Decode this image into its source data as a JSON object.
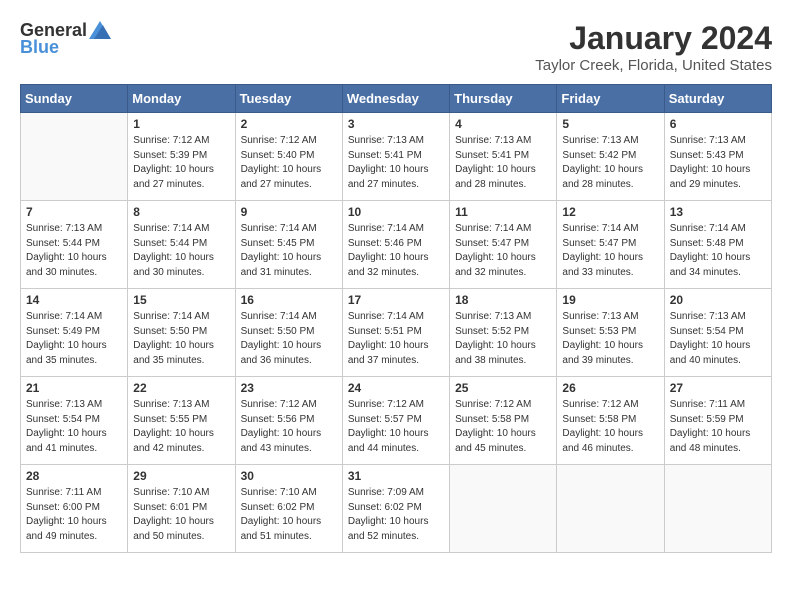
{
  "header": {
    "logo_general": "General",
    "logo_blue": "Blue",
    "title": "January 2024",
    "subtitle": "Taylor Creek, Florida, United States"
  },
  "days_of_week": [
    "Sunday",
    "Monday",
    "Tuesday",
    "Wednesday",
    "Thursday",
    "Friday",
    "Saturday"
  ],
  "weeks": [
    [
      {
        "day": "",
        "info": ""
      },
      {
        "day": "1",
        "info": "Sunrise: 7:12 AM\nSunset: 5:39 PM\nDaylight: 10 hours\nand 27 minutes."
      },
      {
        "day": "2",
        "info": "Sunrise: 7:12 AM\nSunset: 5:40 PM\nDaylight: 10 hours\nand 27 minutes."
      },
      {
        "day": "3",
        "info": "Sunrise: 7:13 AM\nSunset: 5:41 PM\nDaylight: 10 hours\nand 27 minutes."
      },
      {
        "day": "4",
        "info": "Sunrise: 7:13 AM\nSunset: 5:41 PM\nDaylight: 10 hours\nand 28 minutes."
      },
      {
        "day": "5",
        "info": "Sunrise: 7:13 AM\nSunset: 5:42 PM\nDaylight: 10 hours\nand 28 minutes."
      },
      {
        "day": "6",
        "info": "Sunrise: 7:13 AM\nSunset: 5:43 PM\nDaylight: 10 hours\nand 29 minutes."
      }
    ],
    [
      {
        "day": "7",
        "info": "Sunrise: 7:13 AM\nSunset: 5:44 PM\nDaylight: 10 hours\nand 30 minutes."
      },
      {
        "day": "8",
        "info": "Sunrise: 7:14 AM\nSunset: 5:44 PM\nDaylight: 10 hours\nand 30 minutes."
      },
      {
        "day": "9",
        "info": "Sunrise: 7:14 AM\nSunset: 5:45 PM\nDaylight: 10 hours\nand 31 minutes."
      },
      {
        "day": "10",
        "info": "Sunrise: 7:14 AM\nSunset: 5:46 PM\nDaylight: 10 hours\nand 32 minutes."
      },
      {
        "day": "11",
        "info": "Sunrise: 7:14 AM\nSunset: 5:47 PM\nDaylight: 10 hours\nand 32 minutes."
      },
      {
        "day": "12",
        "info": "Sunrise: 7:14 AM\nSunset: 5:47 PM\nDaylight: 10 hours\nand 33 minutes."
      },
      {
        "day": "13",
        "info": "Sunrise: 7:14 AM\nSunset: 5:48 PM\nDaylight: 10 hours\nand 34 minutes."
      }
    ],
    [
      {
        "day": "14",
        "info": "Sunrise: 7:14 AM\nSunset: 5:49 PM\nDaylight: 10 hours\nand 35 minutes."
      },
      {
        "day": "15",
        "info": "Sunrise: 7:14 AM\nSunset: 5:50 PM\nDaylight: 10 hours\nand 35 minutes."
      },
      {
        "day": "16",
        "info": "Sunrise: 7:14 AM\nSunset: 5:50 PM\nDaylight: 10 hours\nand 36 minutes."
      },
      {
        "day": "17",
        "info": "Sunrise: 7:14 AM\nSunset: 5:51 PM\nDaylight: 10 hours\nand 37 minutes."
      },
      {
        "day": "18",
        "info": "Sunrise: 7:13 AM\nSunset: 5:52 PM\nDaylight: 10 hours\nand 38 minutes."
      },
      {
        "day": "19",
        "info": "Sunrise: 7:13 AM\nSunset: 5:53 PM\nDaylight: 10 hours\nand 39 minutes."
      },
      {
        "day": "20",
        "info": "Sunrise: 7:13 AM\nSunset: 5:54 PM\nDaylight: 10 hours\nand 40 minutes."
      }
    ],
    [
      {
        "day": "21",
        "info": "Sunrise: 7:13 AM\nSunset: 5:54 PM\nDaylight: 10 hours\nand 41 minutes."
      },
      {
        "day": "22",
        "info": "Sunrise: 7:13 AM\nSunset: 5:55 PM\nDaylight: 10 hours\nand 42 minutes."
      },
      {
        "day": "23",
        "info": "Sunrise: 7:12 AM\nSunset: 5:56 PM\nDaylight: 10 hours\nand 43 minutes."
      },
      {
        "day": "24",
        "info": "Sunrise: 7:12 AM\nSunset: 5:57 PM\nDaylight: 10 hours\nand 44 minutes."
      },
      {
        "day": "25",
        "info": "Sunrise: 7:12 AM\nSunset: 5:58 PM\nDaylight: 10 hours\nand 45 minutes."
      },
      {
        "day": "26",
        "info": "Sunrise: 7:12 AM\nSunset: 5:58 PM\nDaylight: 10 hours\nand 46 minutes."
      },
      {
        "day": "27",
        "info": "Sunrise: 7:11 AM\nSunset: 5:59 PM\nDaylight: 10 hours\nand 48 minutes."
      }
    ],
    [
      {
        "day": "28",
        "info": "Sunrise: 7:11 AM\nSunset: 6:00 PM\nDaylight: 10 hours\nand 49 minutes."
      },
      {
        "day": "29",
        "info": "Sunrise: 7:10 AM\nSunset: 6:01 PM\nDaylight: 10 hours\nand 50 minutes."
      },
      {
        "day": "30",
        "info": "Sunrise: 7:10 AM\nSunset: 6:02 PM\nDaylight: 10 hours\nand 51 minutes."
      },
      {
        "day": "31",
        "info": "Sunrise: 7:09 AM\nSunset: 6:02 PM\nDaylight: 10 hours\nand 52 minutes."
      },
      {
        "day": "",
        "info": ""
      },
      {
        "day": "",
        "info": ""
      },
      {
        "day": "",
        "info": ""
      }
    ]
  ]
}
